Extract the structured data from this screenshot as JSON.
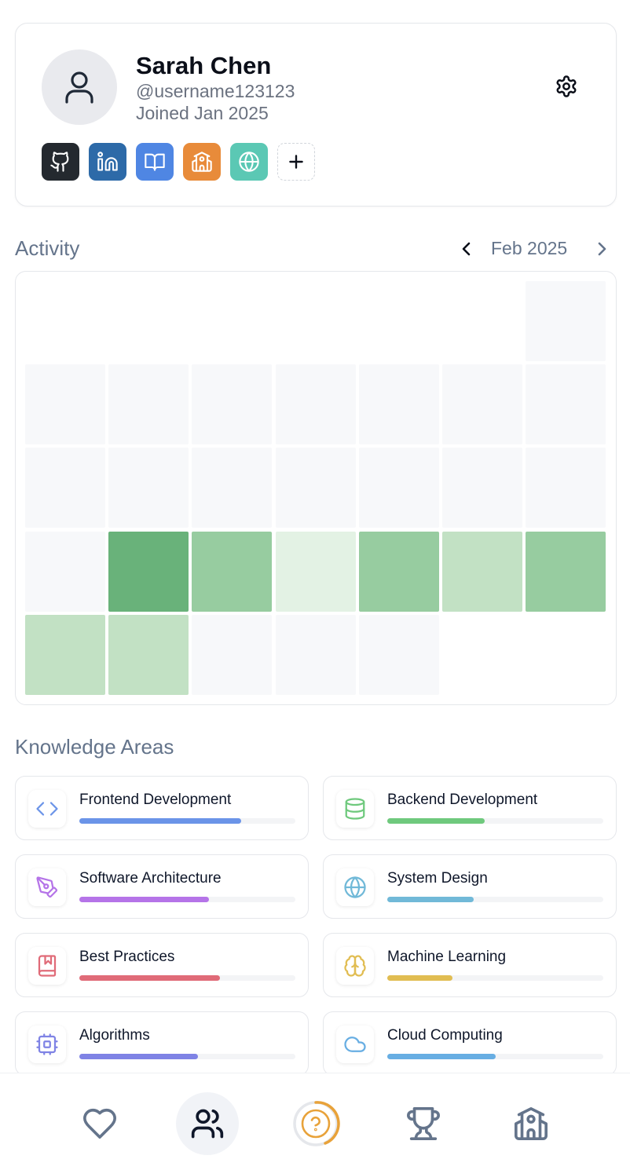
{
  "profile": {
    "name": "Sarah Chen",
    "username": "@username123123",
    "joined": "Joined Jan 2025",
    "socials": [
      {
        "icon": "github-icon",
        "color": "#24292f"
      },
      {
        "icon": "linkedin-icon",
        "color": "#2d6aa8"
      },
      {
        "icon": "book-open-icon",
        "color": "#4f86e3"
      },
      {
        "icon": "school-icon",
        "color": "#e88b3a"
      },
      {
        "icon": "globe-icon",
        "color": "#5bc8b4"
      },
      {
        "icon": "plus-icon",
        "color": "#ffffff"
      }
    ]
  },
  "activity": {
    "title": "Activity",
    "month": "Feb 2025",
    "levels": {
      "0": "#f7f8fa",
      "1": "#e3f2e4",
      "2": "#c2e1c4",
      "3": "#97cca0",
      "4": "#69b27a"
    },
    "days": [
      0,
      0,
      0,
      0,
      0,
      0,
      0,
      0,
      0,
      0,
      0,
      0,
      0,
      0,
      0,
      0,
      4,
      3,
      1,
      3,
      2,
      3,
      2,
      2,
      0,
      0,
      0
    ]
  },
  "knowledge": {
    "title": "Knowledge Areas",
    "items": [
      {
        "label": "Frontend Development",
        "icon": "code-icon",
        "color": "#6b94e8",
        "progress": 0.75
      },
      {
        "label": "Backend Development",
        "icon": "database-icon",
        "color": "#6fc97d",
        "progress": 0.45
      },
      {
        "label": "Software Architecture",
        "icon": "pen-tool-icon",
        "color": "#b574e8",
        "progress": 0.6
      },
      {
        "label": "System Design",
        "icon": "globe-icon",
        "color": "#71b9d8",
        "progress": 0.4
      },
      {
        "label": "Best Practices",
        "icon": "bookmark-book-icon",
        "color": "#e06b78",
        "progress": 0.65
      },
      {
        "label": "Machine Learning",
        "icon": "brain-icon",
        "color": "#e1bd52",
        "progress": 0.3
      },
      {
        "label": "Algorithms",
        "icon": "cpu-icon",
        "color": "#7f83e5",
        "progress": 0.55
      },
      {
        "label": "Cloud Computing",
        "icon": "cloud-icon",
        "color": "#68aee3",
        "progress": 0.5
      }
    ]
  },
  "nav": {
    "items": [
      {
        "icon": "heart-icon",
        "active": false
      },
      {
        "icon": "users-icon",
        "active": true
      },
      {
        "icon": "help-circle-icon",
        "active": false
      },
      {
        "icon": "trophy-icon",
        "active": false
      },
      {
        "icon": "school-icon",
        "active": false
      }
    ]
  }
}
